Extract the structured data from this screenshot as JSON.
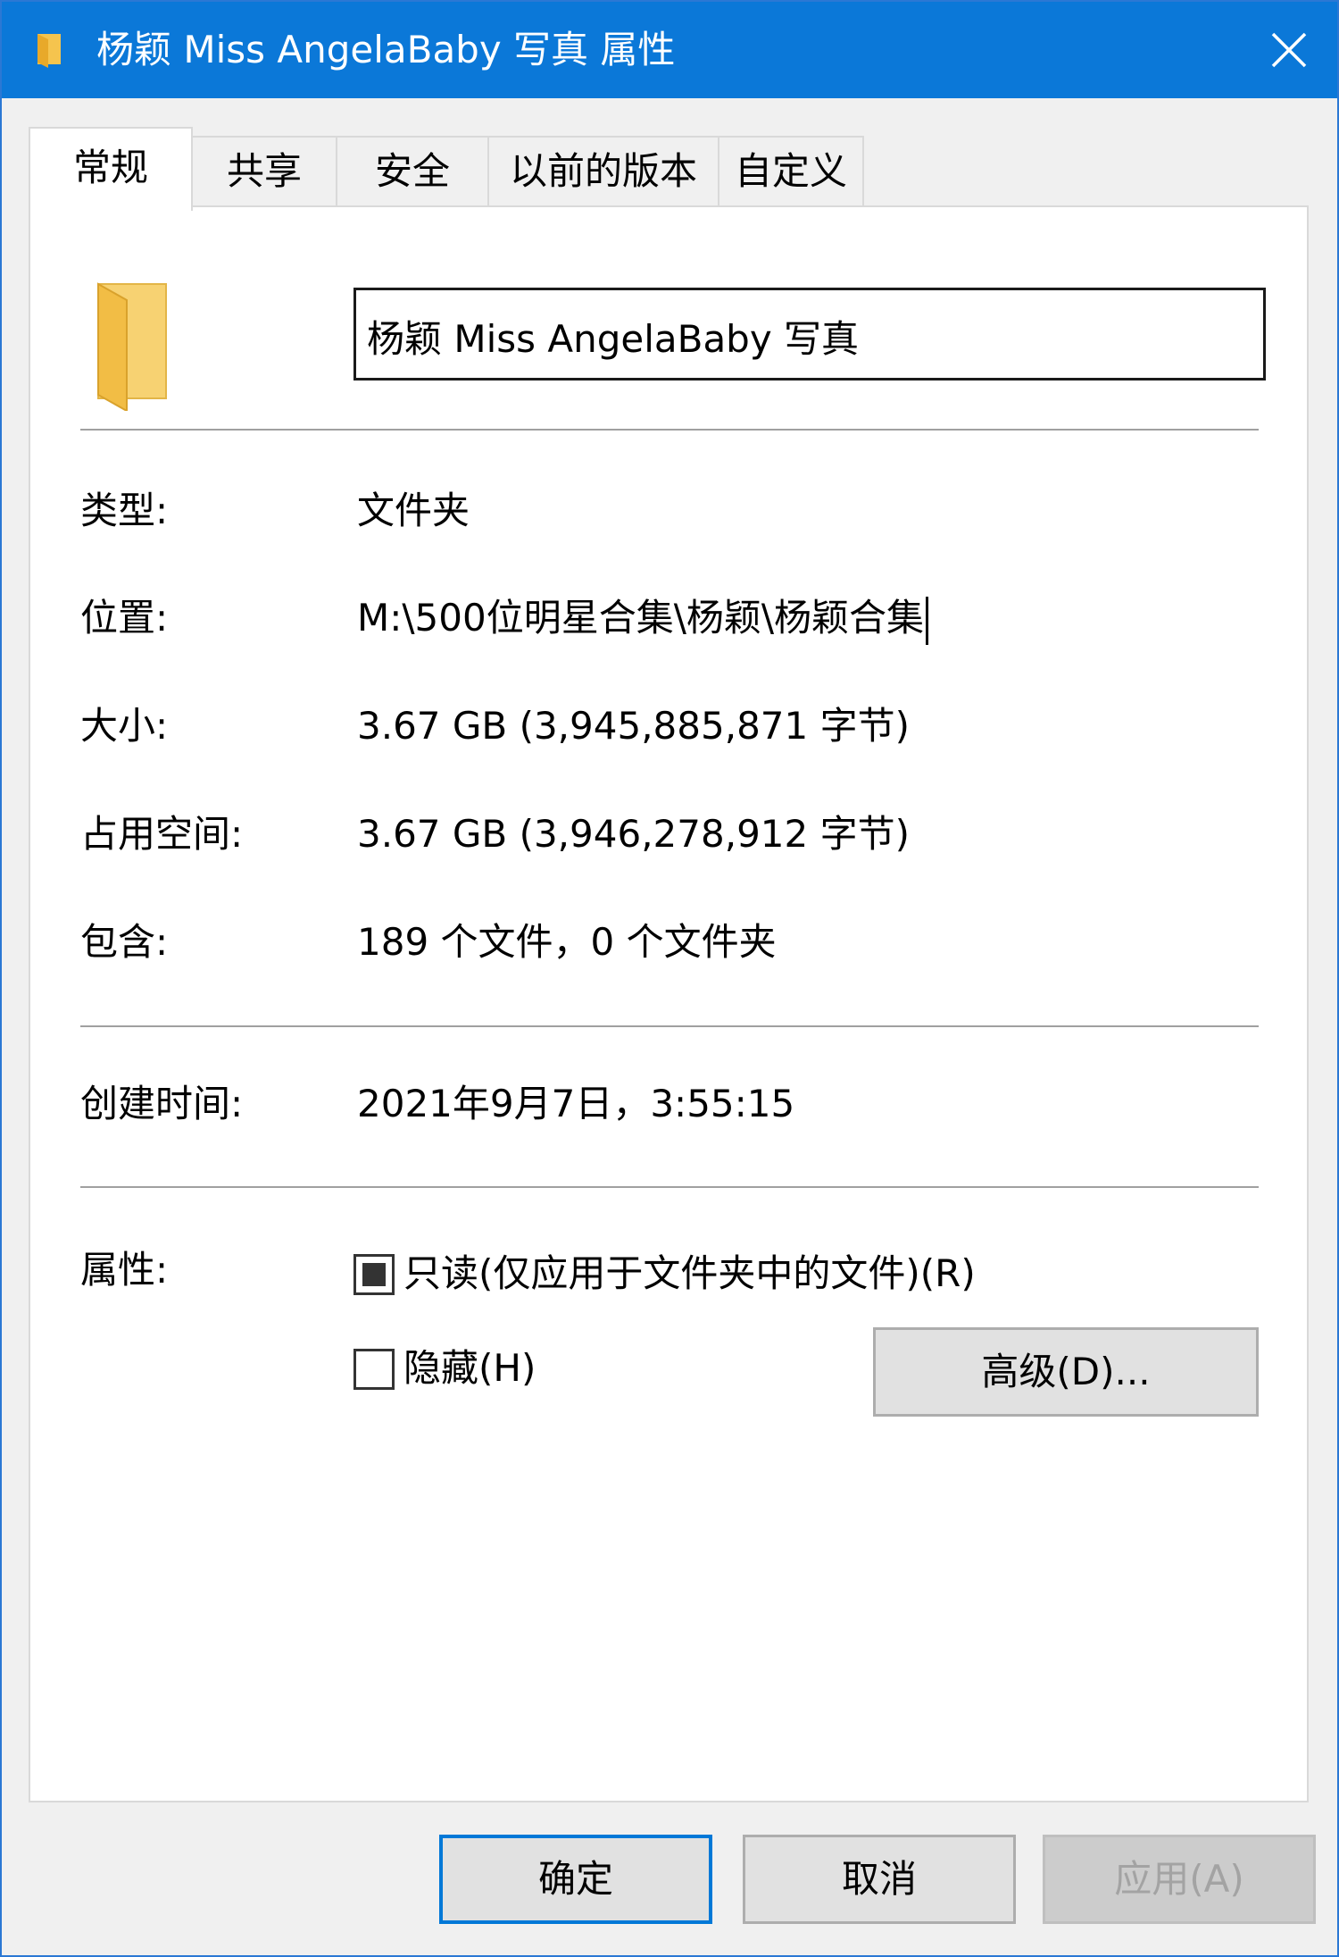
{
  "window": {
    "title": "杨颖 Miss AngelaBaby 写真 属性",
    "title_icon": "folder-icon",
    "close_icon": "close-icon",
    "accent": "#0b78d8"
  },
  "tabs": [
    {
      "label": "常规",
      "active": true
    },
    {
      "label": "共享",
      "active": false
    },
    {
      "label": "安全",
      "active": false
    },
    {
      "label": "以前的版本",
      "active": false
    },
    {
      "label": "自定义",
      "active": false
    }
  ],
  "general": {
    "folder_icon": "folder-icon",
    "name_value": "杨颖 Miss AngelaBaby 写真",
    "type_label": "类型:",
    "type_value": "文件夹",
    "location_label": "位置:",
    "location_value": "M:\\500位明星合集\\杨颖\\杨颖合集",
    "size_label": "大小:",
    "size_value": "3.67 GB (3,945,885,871 字节)",
    "disk_size_label": "占用空间:",
    "disk_size_value": "3.67 GB (3,946,278,912 字节)",
    "contains_label": "包含:",
    "contains_value": "189 个文件，0 个文件夹",
    "created_label": "创建时间:",
    "created_value": "2021年9月7日，3:55:15",
    "attributes_label": "属性:",
    "readonly_label": "只读(仅应用于文件夹中的文件)(R)",
    "readonly_state": "indeterminate",
    "hidden_label": "隐藏(H)",
    "hidden_state": "unchecked",
    "advanced_button": "高级(D)..."
  },
  "footer": {
    "ok": "确定",
    "cancel": "取消",
    "apply": "应用(A)"
  }
}
